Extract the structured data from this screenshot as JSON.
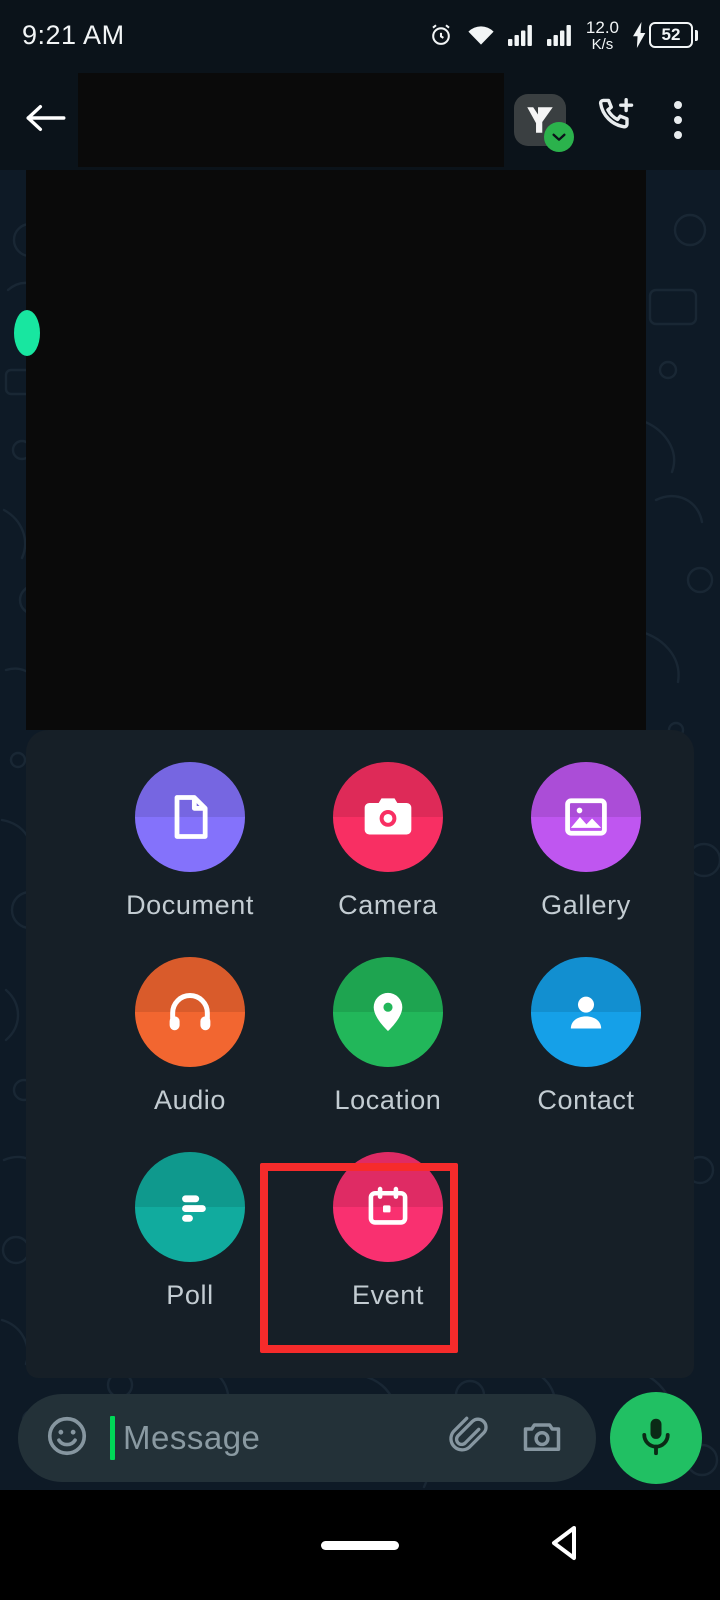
{
  "statusbar": {
    "time": "9:21 AM",
    "network_speed_value": "12.0",
    "network_speed_unit": "K/s",
    "battery_percent": "52",
    "icons": [
      "alarm-icon",
      "wifi-icon",
      "signal-sim1-icon",
      "signal-sim2-icon",
      "charging-bolt-icon",
      "battery-icon"
    ]
  },
  "appbar": {
    "back_label": "Back",
    "contact_name": "",
    "shortcut_icon": "app-shortcut-icon",
    "shortcut_badge": "green-check-badge",
    "add_call_label": "Add call",
    "overflow_label": "More options"
  },
  "attachments": {
    "rows": [
      [
        {
          "label": "Document",
          "icon": "document-icon",
          "color_top": "#7060e8",
          "color_bottom": "#8472fb"
        },
        {
          "label": "Camera",
          "icon": "camera-icon",
          "color_top": "#e02a58",
          "color_bottom": "#f82f63"
        },
        {
          "label": "Gallery",
          "icon": "gallery-icon",
          "color_top": "#ac46d8",
          "color_bottom": "#bf56f0"
        }
      ],
      [
        {
          "label": "Audio",
          "icon": "headphones-icon",
          "color_top": "#e35b2a",
          "color_bottom": "#f26630"
        },
        {
          "label": "Location",
          "icon": "location-pin-icon",
          "color_top": "#1ea34f",
          "color_bottom": "#22b75a"
        },
        {
          "label": "Contact",
          "icon": "person-icon",
          "color_top": "#1291d4",
          "color_bottom": "#15a0e8"
        }
      ],
      [
        {
          "label": "Poll",
          "icon": "poll-bars-icon",
          "color_top": "#0e9b90",
          "color_bottom": "#11ab9e"
        },
        {
          "label": "Event",
          "icon": "calendar-icon",
          "color_top": "#e42a63",
          "color_bottom": "#f93070"
        }
      ]
    ],
    "highlighted_item": "Event",
    "highlight_color": "#f62b2b"
  },
  "composer": {
    "placeholder": "Message",
    "value": "",
    "emoji_label": "Emoji",
    "attach_label": "Attach",
    "camera_label": "Camera",
    "mic_label": "Voice message",
    "accent_green": "#21c063",
    "caret_color": "#00d757"
  },
  "navbar": {
    "home_label": "Home",
    "back_label": "Back"
  }
}
